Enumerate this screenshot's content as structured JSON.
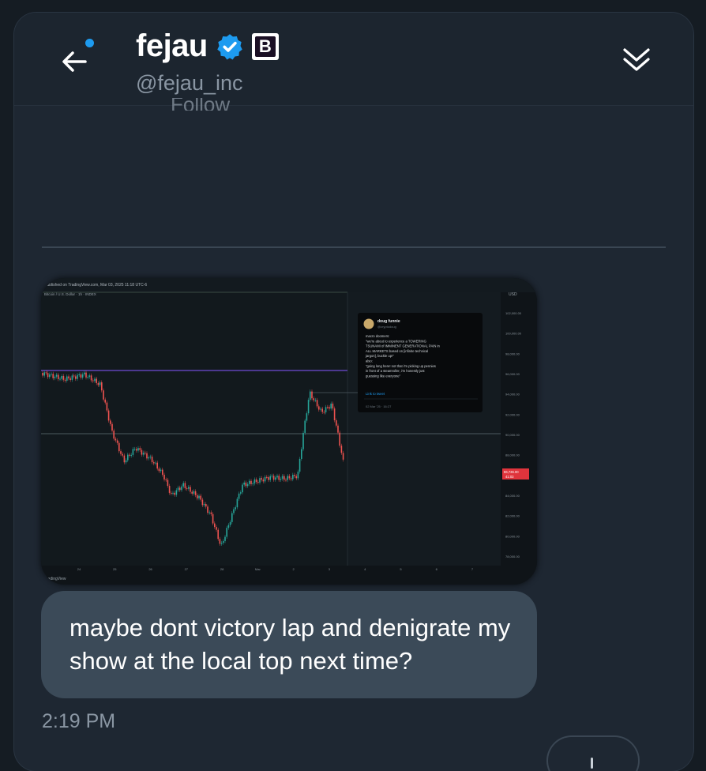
{
  "header": {
    "name": "fejau",
    "handle": "@fejau_inc",
    "affiliate_badge_letter": "B",
    "follow_label": "Follow"
  },
  "message": {
    "text": "maybe dont victory lap and denigrate my show at the local top next time?",
    "timestamp": "2:19 PM"
  },
  "chart_image": {
    "published_line": "Published on TradingView.com, Mar 03, 2025 11:18 UTC-6",
    "symbol_line": "Bitcoin / U.S. Dollar · 1h · INDEX",
    "footer_brand": "TradingView",
    "currency": "USD",
    "price_ticks": [
      "102,000.00",
      "100,000.00",
      "98,000.00",
      "96,000.00",
      "94,000.00",
      "92,000.00",
      "90,000.00",
      "88,000.00",
      "86,000.00",
      "84,000.00",
      "82,000.00",
      "80,000.00",
      "78,000.00"
    ],
    "current_price_label": "86,736.00",
    "current_price_time": "41:03",
    "date_ticks": [
      "24",
      "25",
      "26",
      "27",
      "28",
      "Mar",
      "2",
      "3",
      "4",
      "5",
      "6",
      "7"
    ],
    "embedded_tweet": {
      "name": "doug funnie",
      "handle": "@cryptodoug",
      "lines": [
        "macro doomers:",
        "\"we're about to experience a TOWERING",
        "TSUNAMI of IMMINENT GENERATIONAL PAIN in",
        "ALL MARKETS based on [infinite technical",
        "jargon], buckle up!\"",
        "also:",
        "\"going long here! not that i'm picking up pennies",
        "in front of a steamroller, i'm honestly just",
        "guessing like everyone\""
      ],
      "link_label": "Link to tweet",
      "date": "02 Mar '25 · 16:27"
    }
  },
  "colors": {
    "background": "#151c23",
    "panel": "#1e2732",
    "bubble": "#3b4a58",
    "accent": "#1d9bf0",
    "muted_text": "#8a96a3",
    "candle_up": "#26a69a",
    "candle_down": "#ef5350"
  },
  "icons": {
    "back": "arrow-left-icon",
    "notification": "blue-dot-icon",
    "verified": "verified-badge-icon",
    "collapse": "double-chevron-down-icon"
  }
}
